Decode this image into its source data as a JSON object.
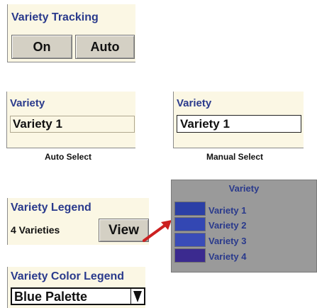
{
  "variety_tracking": {
    "title": "Variety Tracking",
    "buttons": [
      "On",
      "Auto"
    ]
  },
  "auto_select": {
    "title": "Variety",
    "value": "Variety 1",
    "caption": "Auto Select"
  },
  "manual_select": {
    "title": "Variety",
    "value": "Variety 1",
    "caption": "Manual Select"
  },
  "variety_legend": {
    "title": "Variety Legend",
    "count": "4 Varieties",
    "button": "View"
  },
  "legend_popup": {
    "title": "Variety",
    "items": [
      {
        "label": "Variety 1",
        "color": "#2b3fa6"
      },
      {
        "label": "Variety 2",
        "color": "#3347b3"
      },
      {
        "label": "Variety 3",
        "color": "#3a4cb8"
      },
      {
        "label": "Variety 4",
        "color": "#3b2a8f"
      }
    ]
  },
  "color_legend": {
    "title": "Variety Color Legend",
    "value": "Blue Palette"
  },
  "colors": {
    "title_text": "#2a3a8c",
    "panel_bg": "#fbf7e4",
    "button_bg": "#d4d0c4",
    "arrow": "#cc2020"
  }
}
